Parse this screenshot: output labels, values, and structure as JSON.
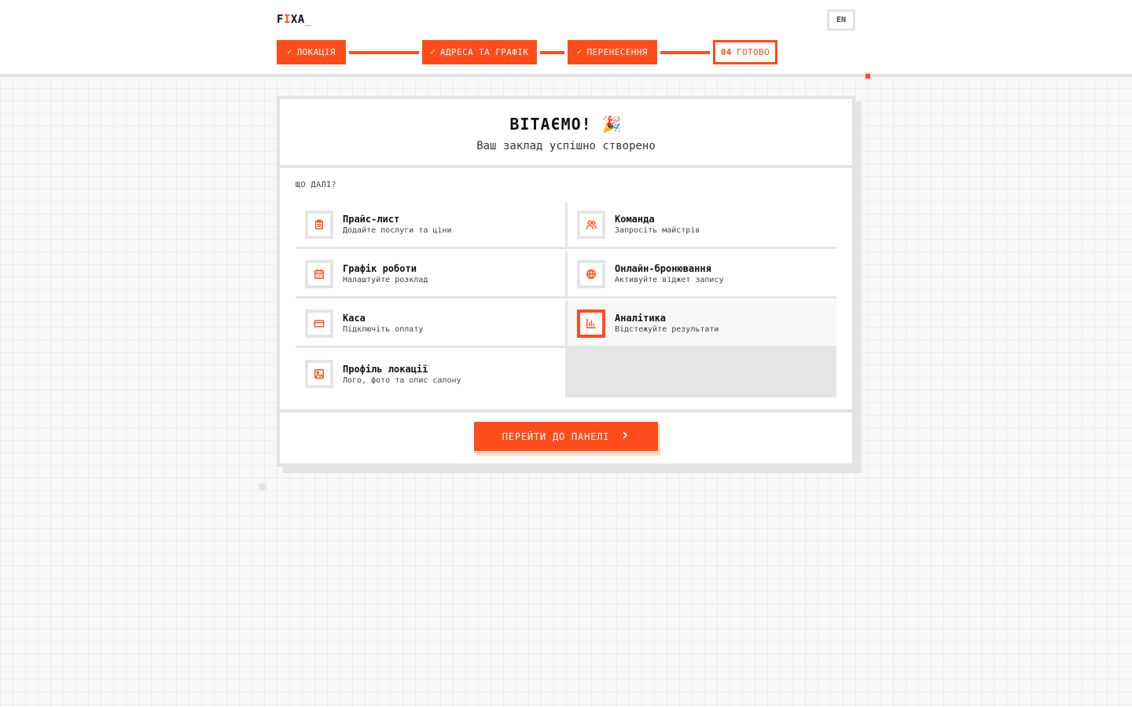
{
  "app": {
    "logo": {
      "first": "F",
      "accent": "I",
      "rest": "XA",
      "cursor": "_"
    }
  },
  "header": {
    "lang_label": "EN"
  },
  "stepper": {
    "steps": [
      {
        "label": "ЛОКАЦІЯ",
        "done": true
      },
      {
        "label": "АДРЕСА ТА ГРАФІК",
        "done": true
      },
      {
        "label": "ПЕРЕНЕСЕННЯ",
        "done": true
      },
      {
        "num": "04",
        "label": "ГОТОВО",
        "current": true
      }
    ]
  },
  "card": {
    "title": "ВІТАЄМО! 🎉",
    "subtitle": "Ваш заклад успішно створено",
    "section_label": "ЩО ДАЛІ?",
    "items": [
      {
        "title": "Прайс-лист",
        "desc": "Додайте послуги та ціни",
        "icon": "clipboard-icon"
      },
      {
        "title": "Команда",
        "desc": "Запросіть майстрів",
        "icon": "users-icon"
      },
      {
        "title": "Графік роботи",
        "desc": "Налаштуйте розклад",
        "icon": "calendar-icon"
      },
      {
        "title": "Онлайн-бронювання",
        "desc": "Активуйте віджет запису",
        "icon": "globe-icon"
      },
      {
        "title": "Каса",
        "desc": "Підключіть оплату",
        "icon": "credit-card-icon"
      },
      {
        "title": "Аналітика",
        "desc": "Відстежуйте результати",
        "icon": "bar-chart-icon"
      },
      {
        "title": "Профіль локації",
        "desc": "Лого, фото та опис салону",
        "icon": "image-icon"
      }
    ],
    "cta_label": "ПЕРЕЙТИ ДО ПАНЕЛІ"
  },
  "colors": {
    "accent": "#ff4c1b",
    "border": "#e3e3e3"
  }
}
